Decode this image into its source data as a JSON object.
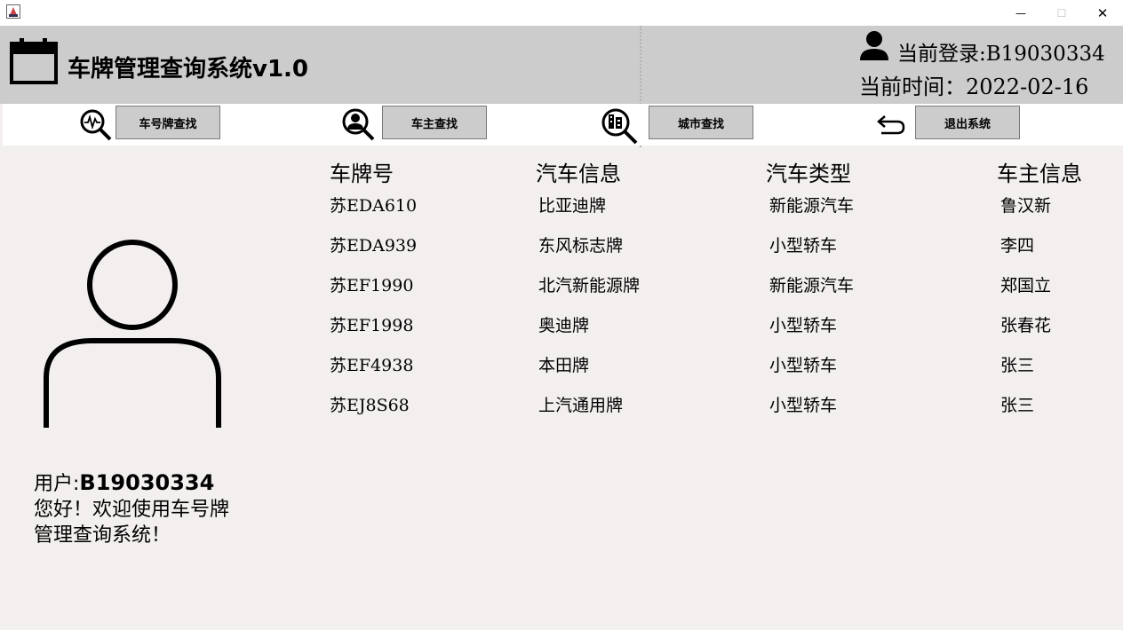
{
  "window": {
    "minimize_symbol": "—",
    "maximize_symbol": "☐",
    "close_symbol": "✕"
  },
  "header": {
    "title": "车牌管理查询系统v1.0",
    "login": "当前登录:B19030334",
    "time": "当前时间：2022-02-16"
  },
  "toolbar": {
    "plate_search": "车号牌查找",
    "owner_search": "车主查找",
    "city_search": "城市查找",
    "exit": "退出系统"
  },
  "sidebar": {
    "user_label": "用户:",
    "user_id": "B19030334",
    "welcome": "您好！欢迎使用车号牌管理查询系统！"
  },
  "table": {
    "headers": [
      "车牌号",
      "汽车信息",
      "汽车类型",
      "车主信息"
    ],
    "rows": [
      [
        "苏EDA610",
        "比亚迪牌",
        "新能源汽车",
        "鲁汉新"
      ],
      [
        "苏EDA939",
        "东风标志牌",
        "小型轿车",
        "李四"
      ],
      [
        "苏EF1990",
        "北汽新能源牌",
        "新能源汽车",
        "郑国立"
      ],
      [
        "苏EF1998",
        "奥迪牌",
        "小型轿车",
        "张春花"
      ],
      [
        "苏EF4938",
        "本田牌",
        "小型轿车",
        "张三"
      ],
      [
        "苏EJ8S68",
        "上汽通用牌",
        "小型轿车",
        "张三"
      ]
    ]
  }
}
